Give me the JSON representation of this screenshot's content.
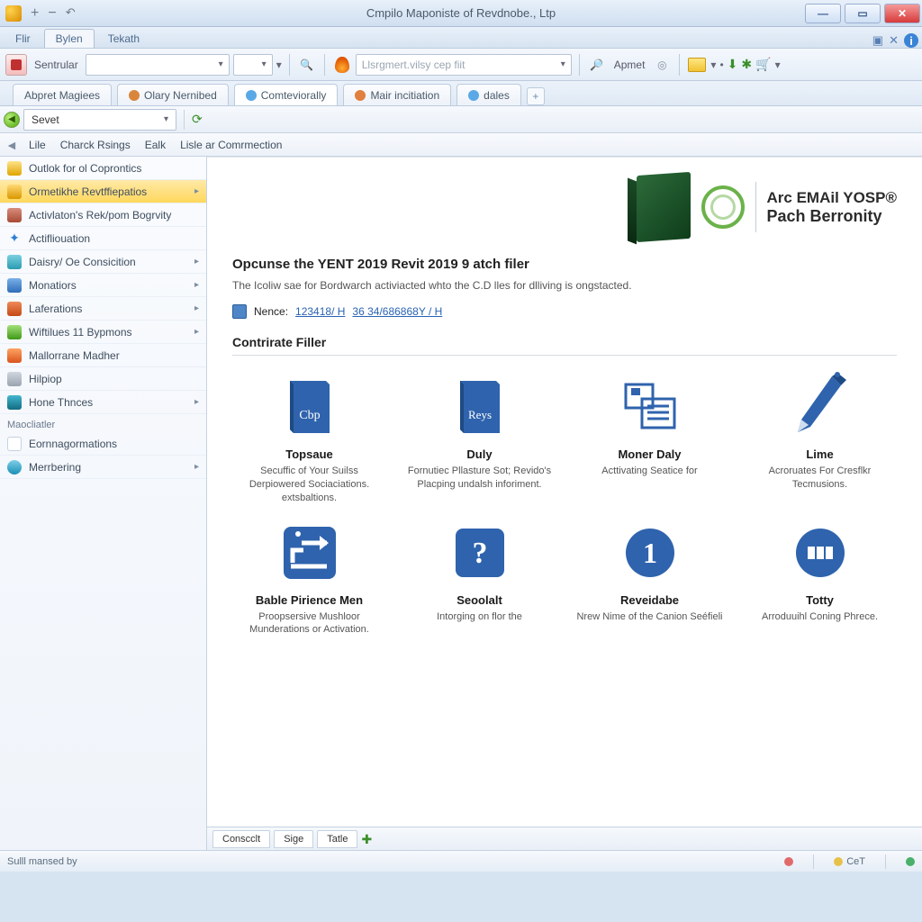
{
  "window": {
    "title": "Cmpilo Maponiste of Revdnobe., Ltp"
  },
  "ribbon_tabs": {
    "items": [
      "Flir",
      "Bylen",
      "Tekath"
    ],
    "active_index": 1
  },
  "toolbar": {
    "filter_label": "Sentrular",
    "combo1_text": "",
    "combo2_text": "",
    "search_placeholder": "Llsrgmert.vilsy cep fiit",
    "after_search_label": "Apmet"
  },
  "doc_tabs": {
    "items": [
      {
        "label": "Abpret Magiees",
        "icon_color": null,
        "active": false
      },
      {
        "label": "Olary Nernibed",
        "icon_color": "#d9863c",
        "active": false
      },
      {
        "label": "Comteviorally",
        "icon_color": "#5aa9e6",
        "active": true
      },
      {
        "label": "Mair incitiation",
        "icon_color": "#e17f3e",
        "active": false
      },
      {
        "label": "dales",
        "icon_color": "#5aa9e6",
        "active": false
      }
    ]
  },
  "sevet": {
    "label": "Sevet"
  },
  "menu": {
    "items": [
      "Lile",
      "Charck Rsings",
      "Ealk",
      "Lisle ar Comrmection"
    ]
  },
  "sidebar": {
    "section1": [
      {
        "label": "Outlok for ol Coprontics",
        "icon": "key",
        "arrow": false
      },
      {
        "label": "Ormetikhe Revtffiepatios",
        "icon": "gold",
        "arrow": true,
        "selected": true
      },
      {
        "label": "Activlaton's Rek/pom Bogrvity",
        "icon": "box",
        "arrow": false
      },
      {
        "label": "Actifliouation",
        "icon": "star",
        "arrow": false
      },
      {
        "label": "Daisry/ Oe Consicition",
        "icon": "teal",
        "arrow": true
      },
      {
        "label": "Monatiors",
        "icon": "blue",
        "arrow": true
      },
      {
        "label": "Laferations",
        "icon": "red",
        "arrow": true
      },
      {
        "label": "Wiftilues 11 Bypmons",
        "icon": "green",
        "arrow": true
      },
      {
        "label": "Mallorrane Madher",
        "icon": "ff",
        "arrow": false
      },
      {
        "label": "Hilpiop",
        "icon": "gray",
        "arrow": false
      },
      {
        "label": "Hone Thnces",
        "icon": "tealP",
        "arrow": true
      }
    ],
    "section2_label": "Maocliatler",
    "section2": [
      {
        "label": "Eornnagormations",
        "icon": "swatch",
        "arrow": false
      },
      {
        "label": "Merrbering",
        "icon": "cyan",
        "arrow": true
      }
    ]
  },
  "brand": {
    "line1": "Arc EMAil YOSP®",
    "line2": "Pach Berronity"
  },
  "page": {
    "headline": "Opcunse the YENT 2019 Revit 2019 9 atch filer",
    "subline": "The Icoliw sae for Bordwarch activiacted whto the C.D lles for dlliving is ongstacted.",
    "ref_label": "Nence:",
    "ref_link1": "123418/ H",
    "ref_link2": "36 34/686868Y / H",
    "section_heading": "Contrirate Filler",
    "tiles": [
      {
        "name": "Topsaue",
        "desc": "Secuffic of Your Suilss Derpiowered Sociaciations. extsbaltions.",
        "shape": "book-cbp"
      },
      {
        "name": "Duly",
        "desc": "Fornutiec Pllasture Sot; Revido's Placping undalsh inforiment.",
        "shape": "book-reys"
      },
      {
        "name": "Moner Daly",
        "desc": "Acttivating Seatice for",
        "shape": "docs"
      },
      {
        "name": "Lime",
        "desc": "Acroruates For Cresflkr Tecmusions.",
        "shape": "pencil"
      },
      {
        "name": "Bable Pirience Men",
        "desc": "Proopsersive Mushloor Munderations or Activation.",
        "shape": "route"
      },
      {
        "name": "Seoolalt",
        "desc": "Intorging on flor the",
        "shape": "question"
      },
      {
        "name": "Reveidabe",
        "desc": "Nrew Nime of the Canion Seéfieli",
        "shape": "one"
      },
      {
        "name": "Totty",
        "desc": "Arroduuihl Coning Phrece.",
        "shape": "slots"
      }
    ]
  },
  "bottom_tabs": {
    "items": [
      "Conscclt",
      "Sige",
      "Tatle"
    ]
  },
  "status": {
    "left": "Sulll mansed by",
    "cell1": "CeT"
  }
}
